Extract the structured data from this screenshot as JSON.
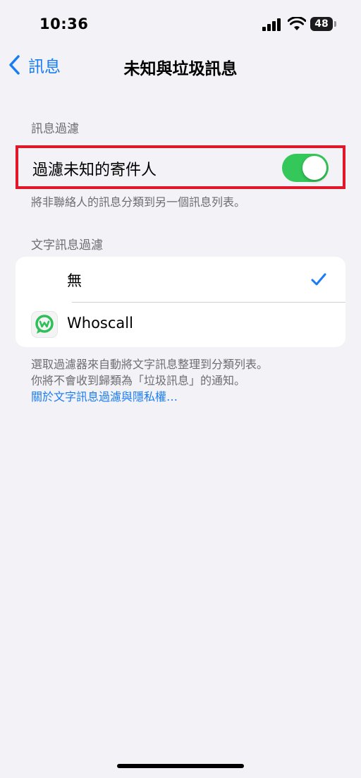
{
  "status_bar": {
    "time": "10:36",
    "battery": "48"
  },
  "nav": {
    "back_label": "訊息",
    "title": "未知與垃圾訊息"
  },
  "filter_section": {
    "header": "訊息過濾",
    "toggle_label": "過濾未知的寄件人",
    "toggle_on": true,
    "footer": "將非聯絡人的訊息分類到另一個訊息列表。"
  },
  "sms_filter_section": {
    "header": "文字訊息過濾",
    "options": [
      {
        "label": "無",
        "selected": true
      },
      {
        "label": "Whoscall",
        "selected": false,
        "icon": "whoscall-app-icon"
      }
    ],
    "footer_line1": "選取過濾器來自動將文字訊息整理到分類列表。",
    "footer_line2": "你將不會收到歸類為「垃圾訊息」的通知。",
    "footer_link": "關於文字訊息過濾與隱私權…"
  },
  "colors": {
    "accent": "#1a7cf5",
    "switch_on": "#34c759",
    "highlight_border": "#e0182a",
    "background": "#f2f2f7",
    "whoscall_green": "#2fbf5a"
  }
}
